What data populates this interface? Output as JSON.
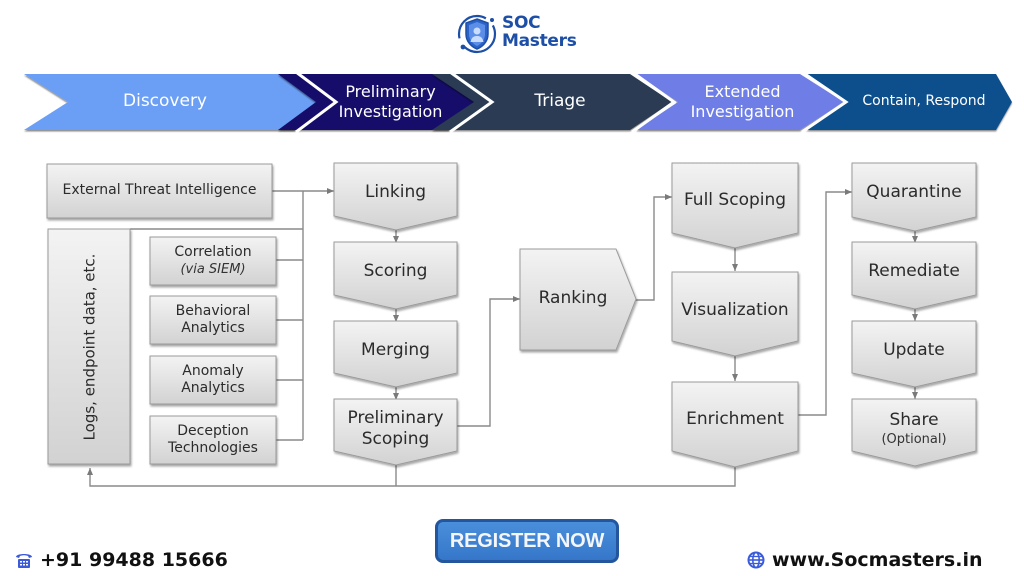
{
  "brand": {
    "logo_icon": "shield-user-icon",
    "name_line1": "SOC",
    "name_line2": "Masters",
    "color": "#1e4fa6"
  },
  "phases": [
    {
      "label": "Discovery",
      "color": "#6b9ff5"
    },
    {
      "label": "Preliminary Investigation",
      "line1": "Preliminary",
      "line2": "Investigation",
      "color": "#120f6b"
    },
    {
      "label": "Triage",
      "color": "#2b3a52"
    },
    {
      "label": "Extended Investigation",
      "line1": "Extended",
      "line2": "Investigation",
      "color": "#6e7ee6"
    },
    {
      "label": "Contain, Respond",
      "color": "#0a4f8c"
    }
  ],
  "inputs": {
    "external_threat_intel": "External Threat Intelligence",
    "logs": "Logs, endpoint data, etc.",
    "sources": [
      {
        "line1": "Correlation",
        "line2": "(via SIEM)"
      },
      {
        "line1": "Behavioral",
        "line2": "Analytics"
      },
      {
        "line1": "Anomaly",
        "line2": "Analytics"
      },
      {
        "line1": "Deception",
        "line2": "Technologies"
      }
    ]
  },
  "preliminary_steps": [
    {
      "line1": "Linking"
    },
    {
      "line1": "Scoring"
    },
    {
      "line1": "Merging"
    },
    {
      "line1": "Preliminary",
      "line2": "Scoping"
    }
  ],
  "triage_step": {
    "line1": "Ranking"
  },
  "extended_steps": [
    {
      "line1": "Full Scoping"
    },
    {
      "line1": "Visualization"
    },
    {
      "line1": "Enrichment"
    }
  ],
  "respond_steps": [
    {
      "line1": "Quarantine"
    },
    {
      "line1": "Remediate"
    },
    {
      "line1": "Update"
    },
    {
      "line1": "Share",
      "line2": "(Optional)"
    }
  ],
  "footer": {
    "phone_icon": "telephone-icon",
    "phone": "+91 99488 15666",
    "register_label": "REGISTER NOW",
    "web_icon": "globe-icon",
    "website": "www.Socmasters.in",
    "icon_color": "#3b5bdb"
  }
}
